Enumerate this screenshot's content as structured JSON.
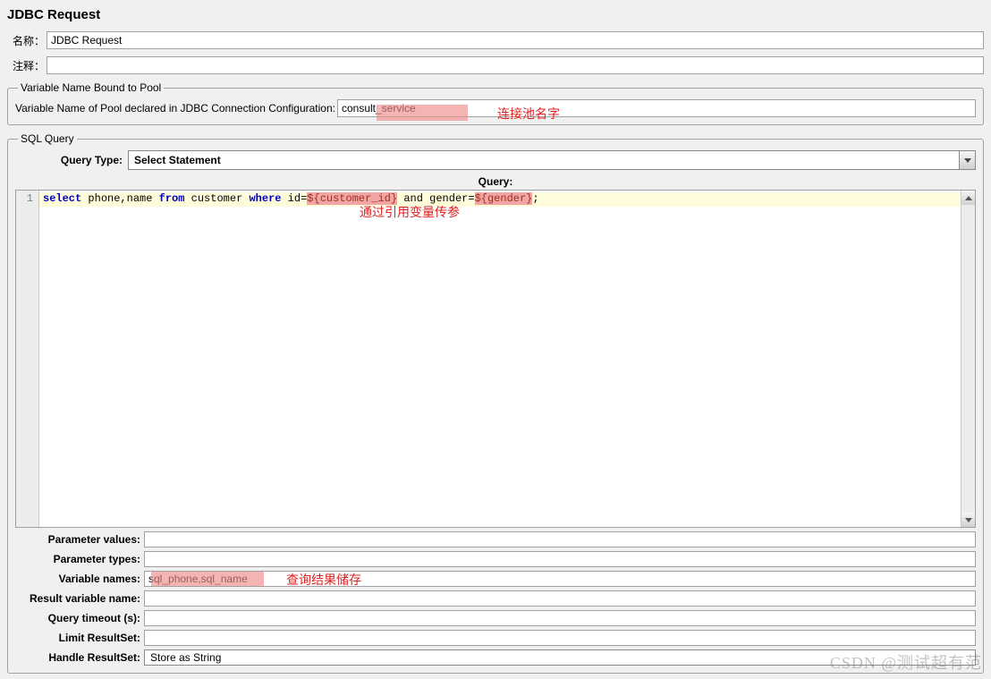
{
  "title": "JDBC Request",
  "name": {
    "label": "名称：",
    "value": "JDBC Request"
  },
  "comment": {
    "label": "注释：",
    "value": ""
  },
  "pool": {
    "legend": "Variable Name Bound to Pool",
    "label": "Variable Name of Pool declared in JDBC Connection Configuration:",
    "value": "consult_service"
  },
  "sql": {
    "legend": "SQL Query",
    "query_type_label": "Query Type:",
    "query_type_value": "Select Statement",
    "query_header": "Query:",
    "gutter": "1",
    "code": {
      "kw_select": "select",
      "fields": " phone,name ",
      "kw_from": "from",
      "table": " customer ",
      "kw_where": "where",
      "col1": " id=",
      "var1": "${customer_id}",
      "and": " and ",
      "col2": "gender=",
      "var2": "${gender}",
      "end": ";"
    }
  },
  "params": {
    "values": {
      "label": "Parameter values:",
      "value": ""
    },
    "types": {
      "label": "Parameter types:",
      "value": ""
    },
    "names": {
      "label": "Variable names:",
      "value": "sql_phone,sql_name"
    },
    "resultvar": {
      "label": "Result variable name:",
      "value": ""
    },
    "timeout": {
      "label": "Query timeout (s):",
      "value": ""
    },
    "limit": {
      "label": "Limit ResultSet:",
      "value": ""
    },
    "handle": {
      "label": "Handle ResultSet:",
      "value": "Store as String"
    }
  },
  "annotations": {
    "pool_name": "连接池名字",
    "var_ref": "通过引用变量传参",
    "result_store": "查询结果储存"
  },
  "watermark": "CSDN @测试超有范"
}
